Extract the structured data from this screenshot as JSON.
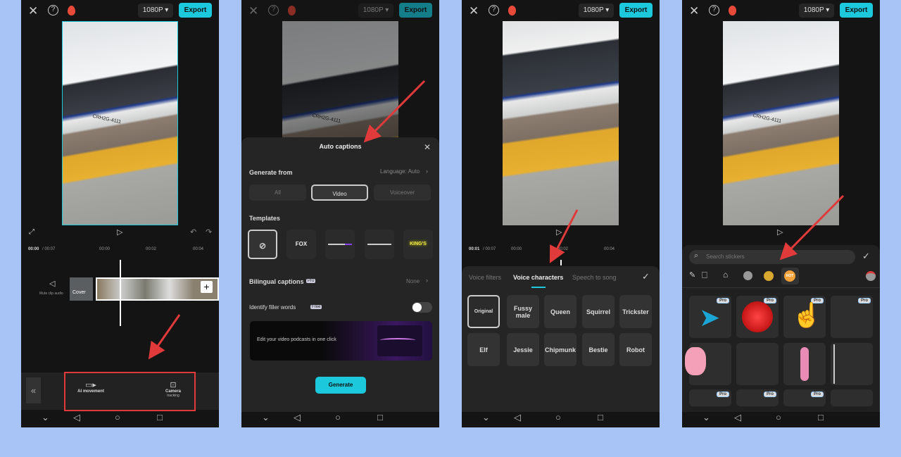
{
  "common": {
    "resolution": "1080P ▾",
    "export": "Export",
    "close_icon": "✕",
    "help_icon": "?",
    "flame_icon": "flame",
    "accent": "#1cc8dc",
    "nav": {
      "down": "⌄",
      "back": "◁",
      "home": "○",
      "recent": "□"
    }
  },
  "panel1": {
    "time_current": "00:00",
    "time_total": "/ 00:07",
    "ticks": [
      "00:00",
      "00:02",
      "00:04"
    ],
    "mute_label": "Mute clip audio",
    "cover_label": "Cover",
    "toolbar": {
      "ai_movement": "AI movement",
      "camera_tracking_1": "Camera",
      "camera_tracking_2": "tracking"
    }
  },
  "panel2": {
    "title": "Auto captions",
    "generate_from": "Generate from",
    "language": "Language: Auto",
    "sources": [
      "All",
      "Video",
      "Voiceover"
    ],
    "selected_source": "Video",
    "templates_label": "Templates",
    "templates": [
      "",
      "FOX",
      "",
      "",
      "KING'S"
    ],
    "bilingual": "Bilingual captions",
    "bilingual_badge": "Pro",
    "bilingual_value": "None",
    "filler": "Identify filler words",
    "filler_badge": "Free",
    "filler_enabled": false,
    "banner": "Edit your video podcasts in one click",
    "generate": "Generate"
  },
  "panel3": {
    "time_current": "00:01",
    "time_total": "/ 00:07",
    "ticks": [
      "00:00",
      "00:02",
      "00:04"
    ],
    "tabs": [
      "Voice filters",
      "Voice characters",
      "Speech to song"
    ],
    "active_tab": "Voice characters",
    "voices": [
      "Original",
      "Fussy male",
      "Queen",
      "Squirrel",
      "Trickster",
      "Elf",
      "Jessie",
      "Chipmunk",
      "Bestie",
      "Robot"
    ],
    "selected_voice": "Original"
  },
  "panel4": {
    "search_placeholder": "Search stickers",
    "pro_badge": "Pro",
    "categories": [
      "pro-ai",
      "bookmark",
      "recent",
      "ai",
      "emoji",
      "hot",
      "settings"
    ],
    "hot_label": "HOT"
  }
}
